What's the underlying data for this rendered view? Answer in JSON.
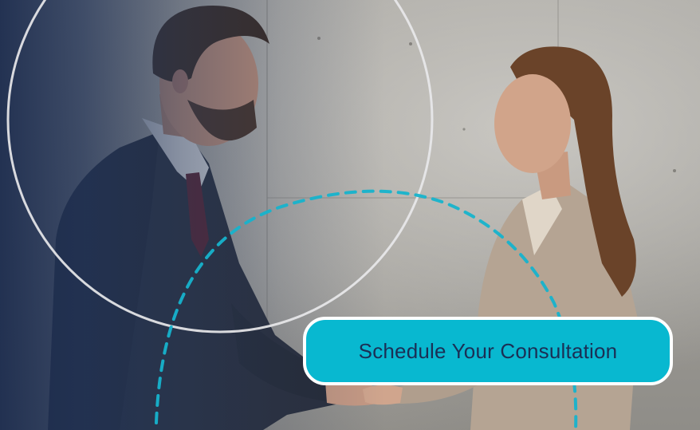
{
  "hero": {
    "image_alt_icon": "business-handshake-photo",
    "cta": {
      "label": "Schedule Your Consultation"
    }
  },
  "colors": {
    "accent": "#08b8d0",
    "cta_text": "#1b2f55",
    "overlay": "#1c2c4e",
    "ring": "#ffffff"
  }
}
